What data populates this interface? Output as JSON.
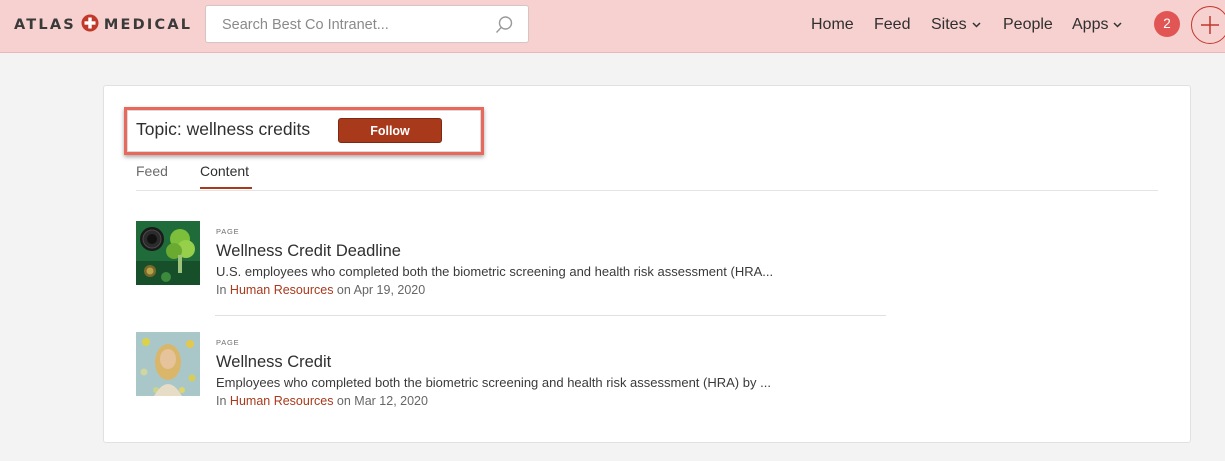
{
  "brand": {
    "left": "ATLAS",
    "right": "MEDICAL",
    "accent": "#c0392b"
  },
  "search": {
    "placeholder": "Search Best Co Intranet..."
  },
  "nav": {
    "items": [
      "Home",
      "Feed",
      "Sites",
      "People",
      "Apps"
    ],
    "notifications": "2"
  },
  "topic": {
    "title": "Topic: wellness credits",
    "follow_label": "Follow"
  },
  "tabs": [
    "Feed",
    "Content"
  ],
  "active_tab": "Content",
  "items": [
    {
      "kind": "PAGE",
      "title": "Wellness Credit Deadline",
      "excerpt": "U.S. employees who completed both the biometric screening and health risk assessment (HRA...",
      "in_label": "In",
      "place": "Human Resources",
      "date": "on Apr 19, 2020"
    },
    {
      "kind": "PAGE",
      "title": "Wellness Credit",
      "excerpt": "Employees who completed both the biometric screening and health risk assessment (HRA) by ...",
      "in_label": "In",
      "place": "Human Resources",
      "date": "on Mar 12, 2020"
    }
  ],
  "colors": {
    "topbar": "#f7d0d0",
    "button": "#a9391b",
    "badge": "#e25555",
    "highlight": "#e8685c"
  }
}
